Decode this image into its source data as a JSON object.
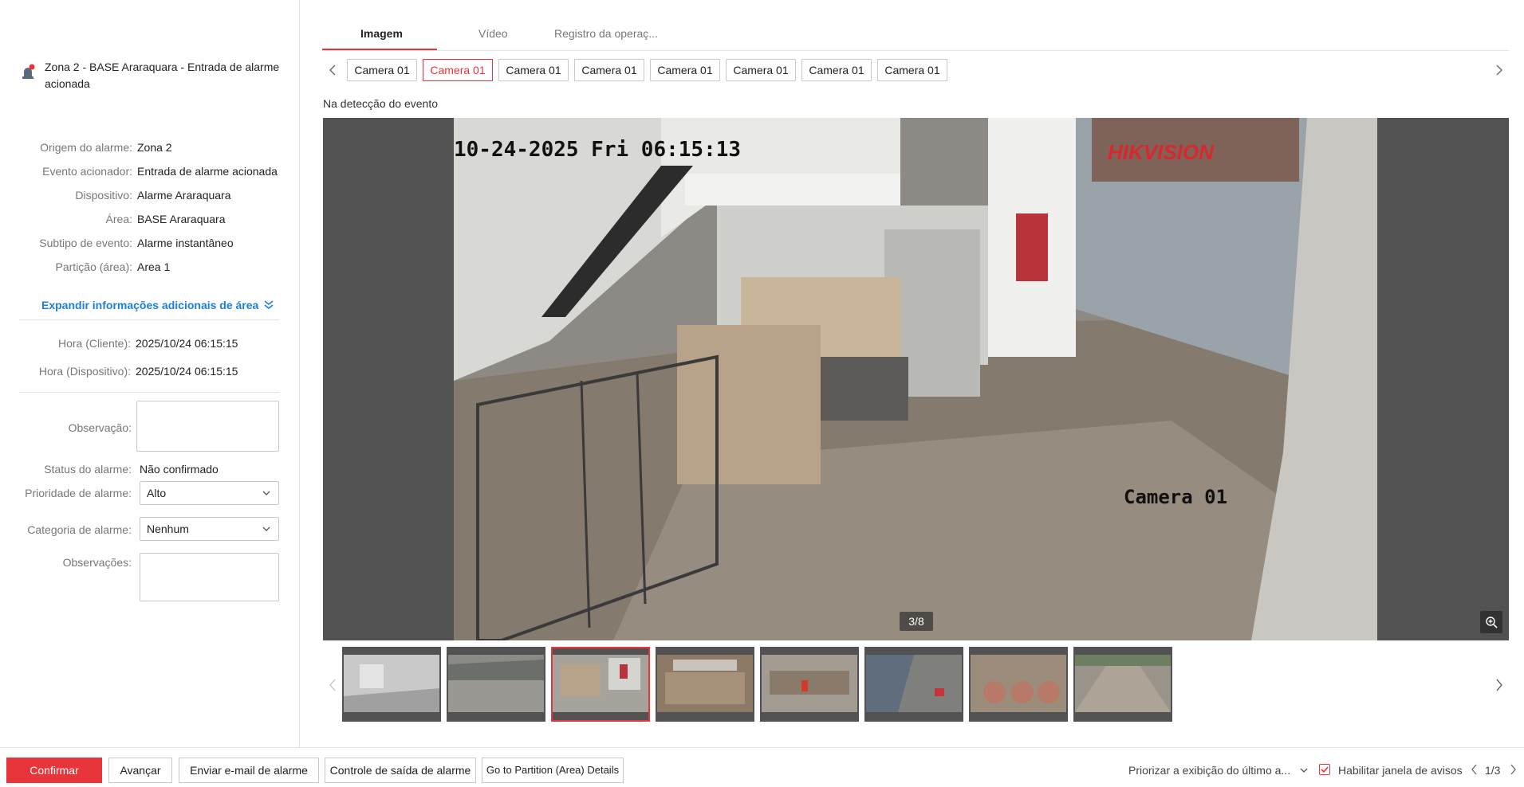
{
  "alarm": {
    "title": "Zona 2 - BASE Araraquara - Entrada de alarme acionada"
  },
  "details": [
    {
      "label": "Origem do alarme:",
      "value": "Zona 2"
    },
    {
      "label": "Evento acionador:",
      "value": "Entrada de alarme acionada"
    },
    {
      "label": "Dispositivo:",
      "value": "Alarme Araraquara"
    },
    {
      "label": "Área:",
      "value": "BASE Araraquara"
    },
    {
      "label": "Subtipo de evento:",
      "value": "Alarme instantâneo"
    },
    {
      "label": "Partição (área):",
      "value": "Area 1"
    }
  ],
  "expand_label": "Expandir informações adicionais de área",
  "times": [
    {
      "label": "Hora (Cliente):",
      "value": "2025/10/24 06:15:15"
    },
    {
      "label": "Hora (Dispositivo):",
      "value": "2025/10/24 06:15:15"
    }
  ],
  "form": {
    "observacao_label": "Observação:",
    "status_label": "Status do alarme:",
    "status_value": "Não confirmado",
    "priority_label": "Prioridade de alarme:",
    "priority_value": "Alto",
    "category_label": "Categoria de alarme:",
    "category_value": "Nenhum",
    "observacoes_label": "Observações:"
  },
  "tabs": [
    "Imagem",
    "Vídeo",
    "Registro da operaç..."
  ],
  "cameras": [
    "Camera 01",
    "Camera 01",
    "Camera 01",
    "Camera 01",
    "Camera 01",
    "Camera 01",
    "Camera 01",
    "Camera 01"
  ],
  "active_camera_index": 1,
  "event_label": "Na detecção do evento",
  "image": {
    "osd_datetime": "10-24-2025 Fri 06:15:13",
    "osd_camera": "Camera 01",
    "brand": "HIKVISION",
    "counter": "3/8"
  },
  "active_thumb_index": 2,
  "bottom": {
    "confirm": "Confirmar",
    "advance": "Avançar",
    "email": "Enviar e-mail de alarme",
    "output": "Controle de saída de alarme",
    "partition": "Go to Partition (Area) Details",
    "prioritize": "Priorizar a exibição do último a...",
    "enable_popup": "Habilitar janela de avisos",
    "page": "1/3"
  },
  "colors": {
    "accent": "#e8343b",
    "link": "#1e7fd6",
    "viewer_bg": "#525252"
  }
}
